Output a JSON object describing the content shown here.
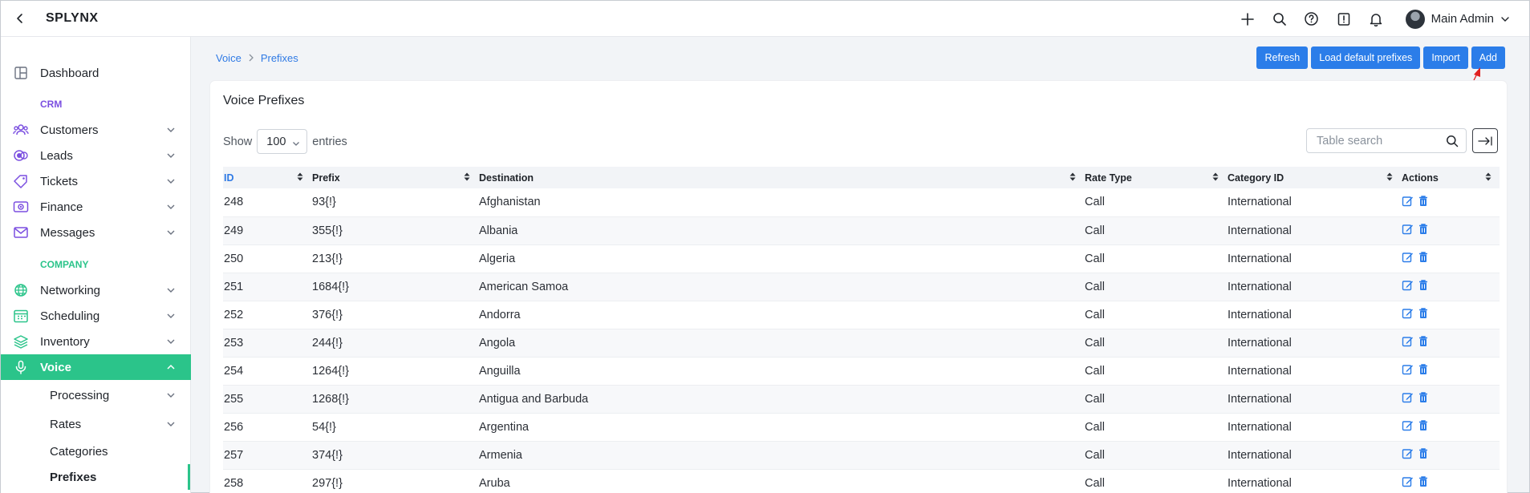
{
  "app": {
    "brand": "SPLYNX",
    "user_name": "Main Admin"
  },
  "sidebar": {
    "dashboard": "Dashboard",
    "crm_section": "CRM",
    "customers": "Customers",
    "leads": "Leads",
    "tickets": "Tickets",
    "finance": "Finance",
    "messages": "Messages",
    "company_section": "COMPANY",
    "networking": "Networking",
    "scheduling": "Scheduling",
    "inventory": "Inventory",
    "voice": "Voice",
    "processing": "Processing",
    "rates": "Rates",
    "categories": "Categories",
    "prefixes": "Prefixes",
    "crm_color": "#7b4fe0",
    "company_color": "#2bc48a",
    "active_color": "#2bc48a"
  },
  "breadcrumb": {
    "parent": "Voice",
    "current": "Prefixes"
  },
  "toolbar": {
    "refresh": "Refresh",
    "load_default": "Load default prefixes",
    "import": "Import",
    "add": "Add"
  },
  "card": {
    "title": "Voice Prefixes",
    "show_label": "Show",
    "entries_value": "100",
    "entries_label": "entries",
    "search_placeholder": "Table search"
  },
  "table": {
    "columns": [
      "ID",
      "Prefix",
      "Destination",
      "Rate Type",
      "Category ID",
      "Actions"
    ],
    "rows": [
      [
        "248",
        "93{!}",
        "Afghanistan",
        "Call",
        "International"
      ],
      [
        "249",
        "355{!}",
        "Albania",
        "Call",
        "International"
      ],
      [
        "250",
        "213{!}",
        "Algeria",
        "Call",
        "International"
      ],
      [
        "251",
        "1684{!}",
        "American Samoa",
        "Call",
        "International"
      ],
      [
        "252",
        "376{!}",
        "Andorra",
        "Call",
        "International"
      ],
      [
        "253",
        "244{!}",
        "Angola",
        "Call",
        "International"
      ],
      [
        "254",
        "1264{!}",
        "Anguilla",
        "Call",
        "International"
      ],
      [
        "255",
        "1268{!}",
        "Antigua and Barbuda",
        "Call",
        "International"
      ],
      [
        "256",
        "54{!}",
        "Argentina",
        "Call",
        "International"
      ],
      [
        "257",
        "374{!}",
        "Armenia",
        "Call",
        "International"
      ],
      [
        "258",
        "297{!}",
        "Aruba",
        "Call",
        "International"
      ]
    ]
  },
  "colors": {
    "primary": "#2b7de9",
    "link": "#2f7ae5",
    "annotation_arrow": "#e02020"
  }
}
